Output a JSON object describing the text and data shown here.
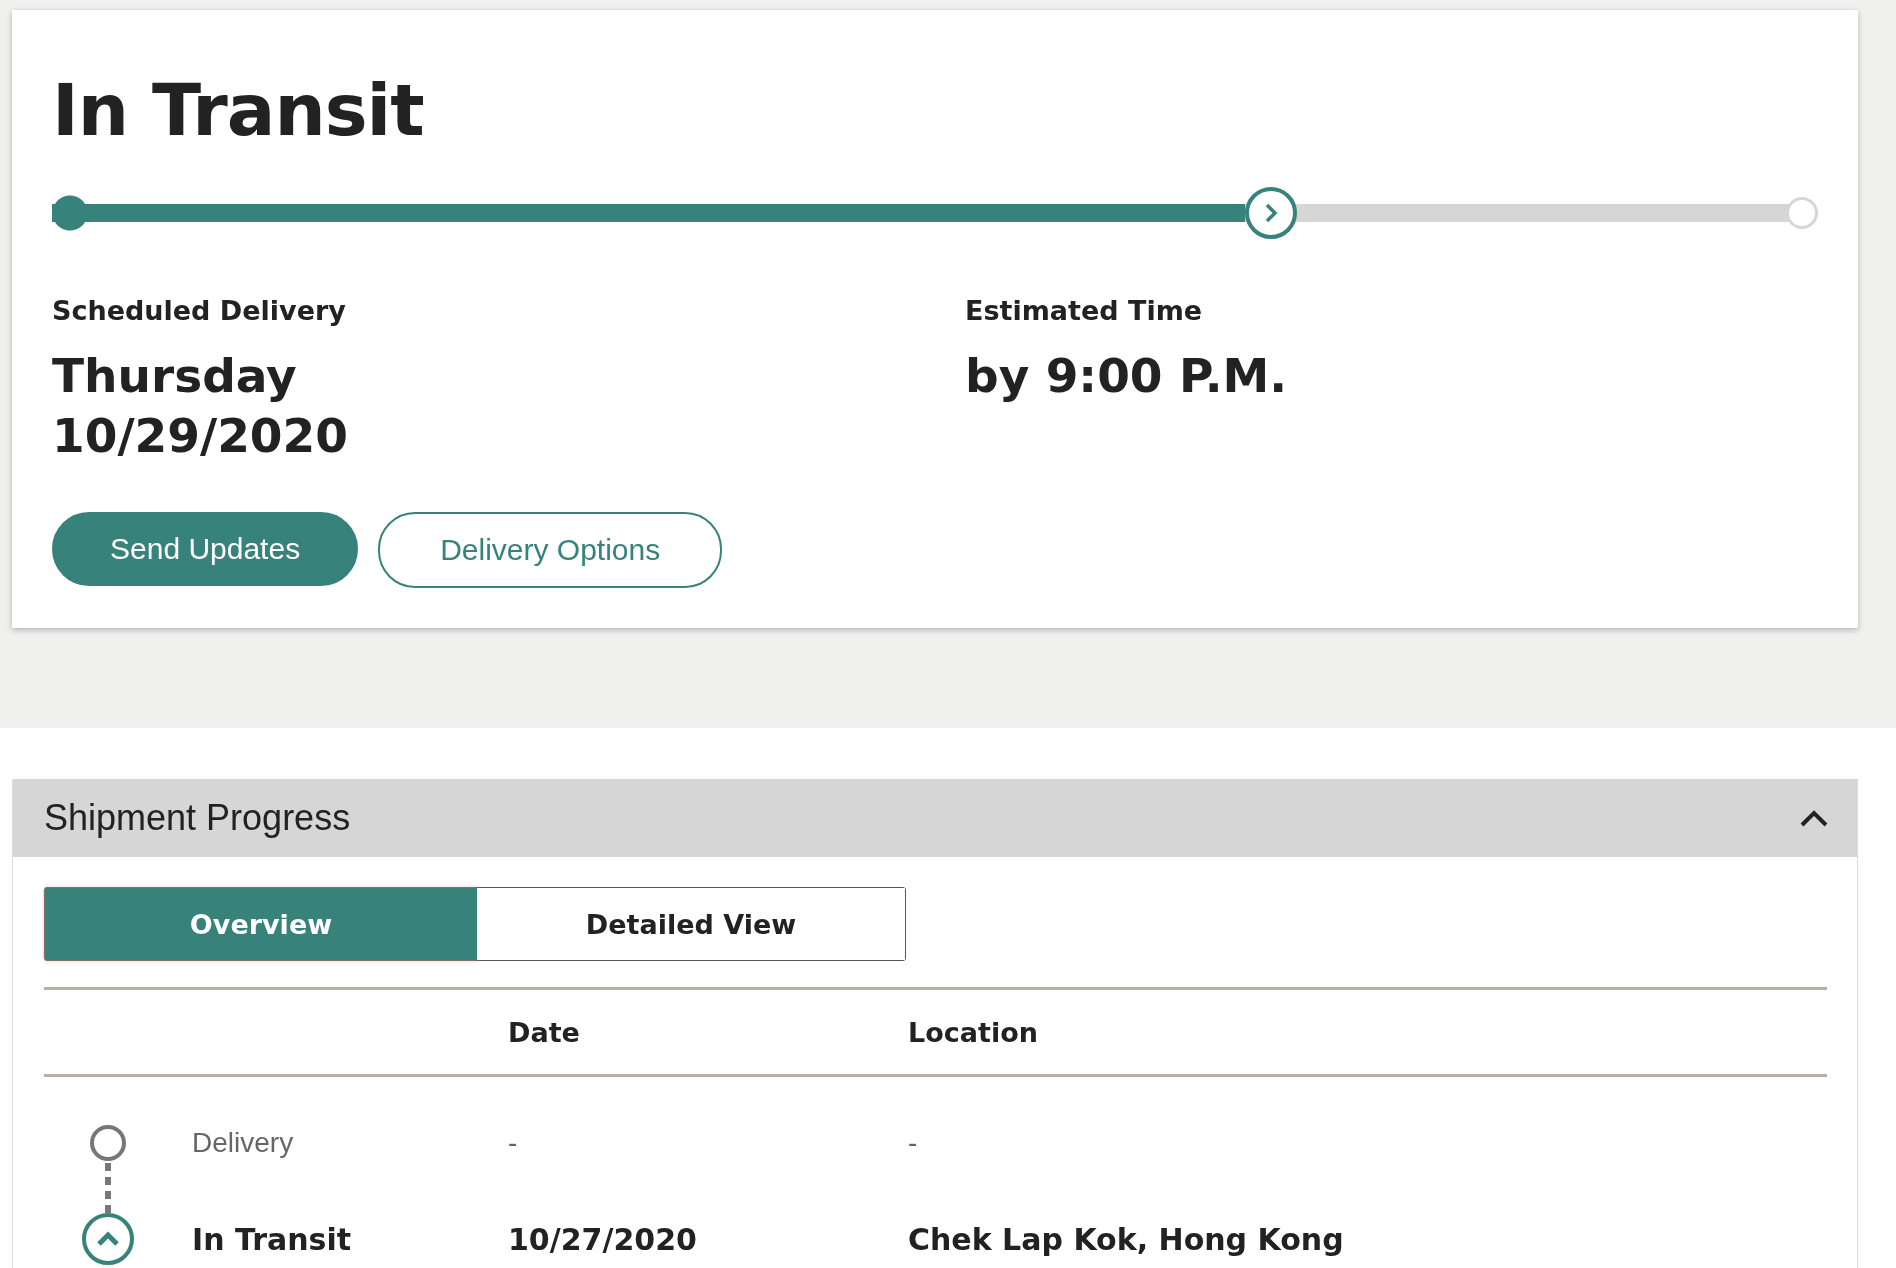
{
  "status": {
    "title": "In Transit",
    "level": 0.69
  },
  "delivery": [
    {
      "label": "Scheduled Delivery",
      "value_lines": [
        "Thursday",
        "10/29/2020"
      ]
    },
    {
      "label": "Estimated Time",
      "value_lines": [
        "by 9:00 P.M."
      ]
    }
  ],
  "buttons": [
    {
      "label": "Send Updates",
      "kind": "primary"
    },
    {
      "label": "Delivery Options",
      "kind": "outline"
    }
  ],
  "shipment_progress": {
    "title": "Shipment Progress",
    "expanded": true,
    "tabs": [
      {
        "label": "Overview",
        "selected": true
      },
      {
        "label": "Detailed View",
        "selected": false
      }
    ],
    "columns": [
      "Date",
      "Location"
    ],
    "rows": [
      {
        "event": "Delivery",
        "date": "-",
        "location": "-",
        "kind": "pending"
      },
      {
        "event": "In Transit",
        "date": "10/27/2020",
        "location": "Chek Lap Kok, Hong Kong",
        "kind": "current"
      }
    ]
  }
}
